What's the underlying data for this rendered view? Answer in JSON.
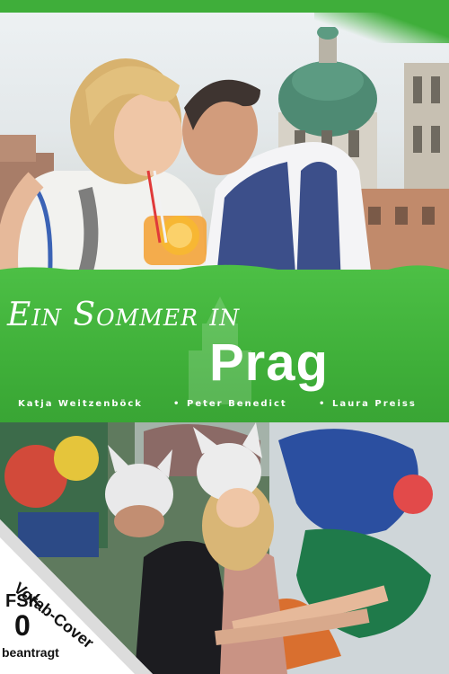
{
  "title": {
    "line1": "Ein Sommer in",
    "line2": "Prag"
  },
  "cast": [
    "Katja Weitzenböck",
    "Peter Benedict",
    "Laura Preiss"
  ],
  "cast_separator": "•",
  "sticker": {
    "banner": "Vorab-Cover",
    "rating_label": "FSK",
    "rating_value": "0",
    "rating_note": "beantragt"
  },
  "colors": {
    "band_green": "#3faf39",
    "text_white": "#ffffff"
  }
}
